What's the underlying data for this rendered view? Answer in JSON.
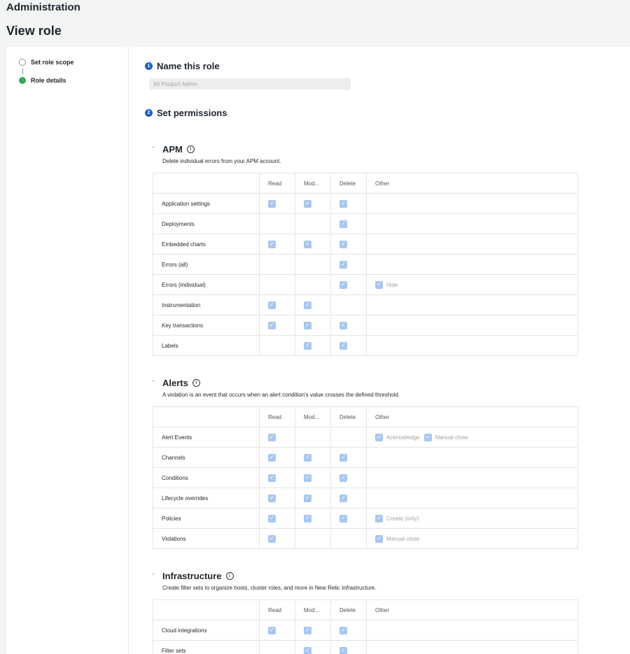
{
  "header": {
    "breadcrumb": "Administration",
    "title": "View role"
  },
  "steps": [
    {
      "label": "Set role scope",
      "state": "incomplete"
    },
    {
      "label": "Role details",
      "state": "current"
    }
  ],
  "role_name": {
    "heading": "Name this role",
    "number": "1",
    "value": "All Product Admin"
  },
  "permissions": {
    "heading": "Set permissions",
    "number": "2"
  },
  "columns": {
    "read": "Read",
    "modify": "Mod...",
    "delete": "Delete",
    "other": "Other"
  },
  "sections": [
    {
      "title": "APM",
      "description": "Delete individual errors from your APM account.",
      "rows": [
        {
          "name": "Application settings",
          "read": true,
          "modify": true,
          "delete": true,
          "other": []
        },
        {
          "name": "Deployments",
          "read": false,
          "modify": false,
          "delete": true,
          "other": []
        },
        {
          "name": "Embedded charts",
          "read": true,
          "modify": true,
          "delete": true,
          "other": []
        },
        {
          "name": "Errors (all)",
          "read": false,
          "modify": false,
          "delete": true,
          "other": []
        },
        {
          "name": "Errors (individual)",
          "read": false,
          "modify": false,
          "delete": true,
          "other": [
            "Hide"
          ]
        },
        {
          "name": "Instrumentation",
          "read": true,
          "modify": true,
          "delete": false,
          "other": []
        },
        {
          "name": "Key transactions",
          "read": true,
          "modify": true,
          "delete": true,
          "other": []
        },
        {
          "name": "Labels",
          "read": false,
          "modify": true,
          "delete": true,
          "other": []
        }
      ]
    },
    {
      "title": "Alerts",
      "description": "A violation is an event that occurs when an alert condition's value crosses the defined threshold.",
      "rows": [
        {
          "name": "Alert Events",
          "read": true,
          "modify": false,
          "delete": false,
          "other": [
            "Acknowledge",
            "Manual close"
          ]
        },
        {
          "name": "Channels",
          "read": true,
          "modify": true,
          "delete": true,
          "other": []
        },
        {
          "name": "Conditions",
          "read": true,
          "modify": true,
          "delete": true,
          "other": []
        },
        {
          "name": "Lifecycle overrides",
          "read": true,
          "modify": true,
          "delete": true,
          "other": []
        },
        {
          "name": "Policies",
          "read": true,
          "modify": true,
          "delete": true,
          "other": [
            "Create (only)"
          ]
        },
        {
          "name": "Violations",
          "read": true,
          "modify": false,
          "delete": false,
          "other": [
            "Manual close"
          ]
        }
      ]
    },
    {
      "title": "Infrastructure",
      "description": "Create filter sets to organize hosts, cluster roles, and more in New Relic Infrastructure.",
      "rows": [
        {
          "name": "Cloud integrations",
          "read": true,
          "modify": true,
          "delete": true,
          "other": []
        },
        {
          "name": "Filter sets",
          "read": false,
          "modify": true,
          "delete": true,
          "other": []
        }
      ]
    }
  ],
  "icons": {
    "chevron": "chevron-down-icon",
    "info": "info-icon",
    "check": "checkmark-icon",
    "step_number": "number-badge-icon"
  },
  "colors": {
    "accent": "#1d61c5",
    "success": "#3ca65b",
    "checkbox": "#a9c7ee"
  }
}
